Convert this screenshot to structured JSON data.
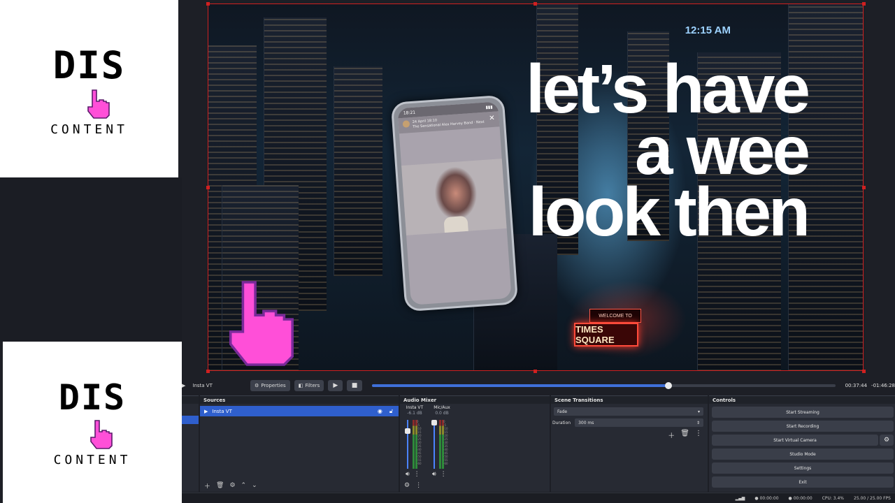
{
  "logo": {
    "word": "DIS",
    "sub": "CONTENT"
  },
  "preview": {
    "clock": "12:15 AM",
    "overlay_lines": [
      "let’s have",
      "a wee",
      "look then"
    ],
    "sign_main": "TIMES SQUARE",
    "sign_small": "WELCOME TO",
    "phone": {
      "time": "18:21",
      "story_date": "24 April  18:10",
      "story_caption": "The Sensational Alex Harvey Band · Next"
    }
  },
  "transport": {
    "source_name": "Insta VT",
    "properties_label": "Properties",
    "filters_label": "Filters",
    "progress": 0.64,
    "elapsed": "00:37:44",
    "remaining": "-01:46:28"
  },
  "sources": {
    "title": "Sources",
    "items": [
      {
        "name": "Insta VT"
      }
    ]
  },
  "mixer": {
    "title": "Audio Mixer",
    "channels": [
      {
        "name": "Insta VT",
        "db": "-6.1 dB"
      },
      {
        "name": "Mic/Aux",
        "db": "0.0 dB"
      }
    ],
    "ticks": [
      "0",
      "-5",
      "-10",
      "-15",
      "-20",
      "-25",
      "-30",
      "-35",
      "-40",
      "-45",
      "-50",
      "-55",
      "-60"
    ]
  },
  "transitions": {
    "title": "Scene Transitions",
    "selected": "Fade",
    "duration_label": "Duration",
    "duration_value": "300 ms"
  },
  "controls": {
    "title": "Controls",
    "start_streaming": "Start Streaming",
    "start_recording": "Start Recording",
    "start_virtual_camera": "Start Virtual Camera",
    "studio_mode": "Studio Mode",
    "settings": "Settings",
    "exit": "Exit"
  },
  "status": {
    "stream_time": "00:00:00",
    "rec_time": "00:00:00",
    "cpu": "CPU: 3.4%",
    "fps": "25.00 / 25.00 FPS"
  },
  "icons": {
    "play": "play-icon",
    "stop": "stop-icon",
    "gear": "gear-icon",
    "eye": "eye-icon",
    "lock": "lock-icon",
    "pointer-hand": "pointer-hand-icon"
  },
  "colors": {
    "accent": "#2f5fcd",
    "selection_outline": "#d02020",
    "hand_pink": "#ff4fd8"
  }
}
